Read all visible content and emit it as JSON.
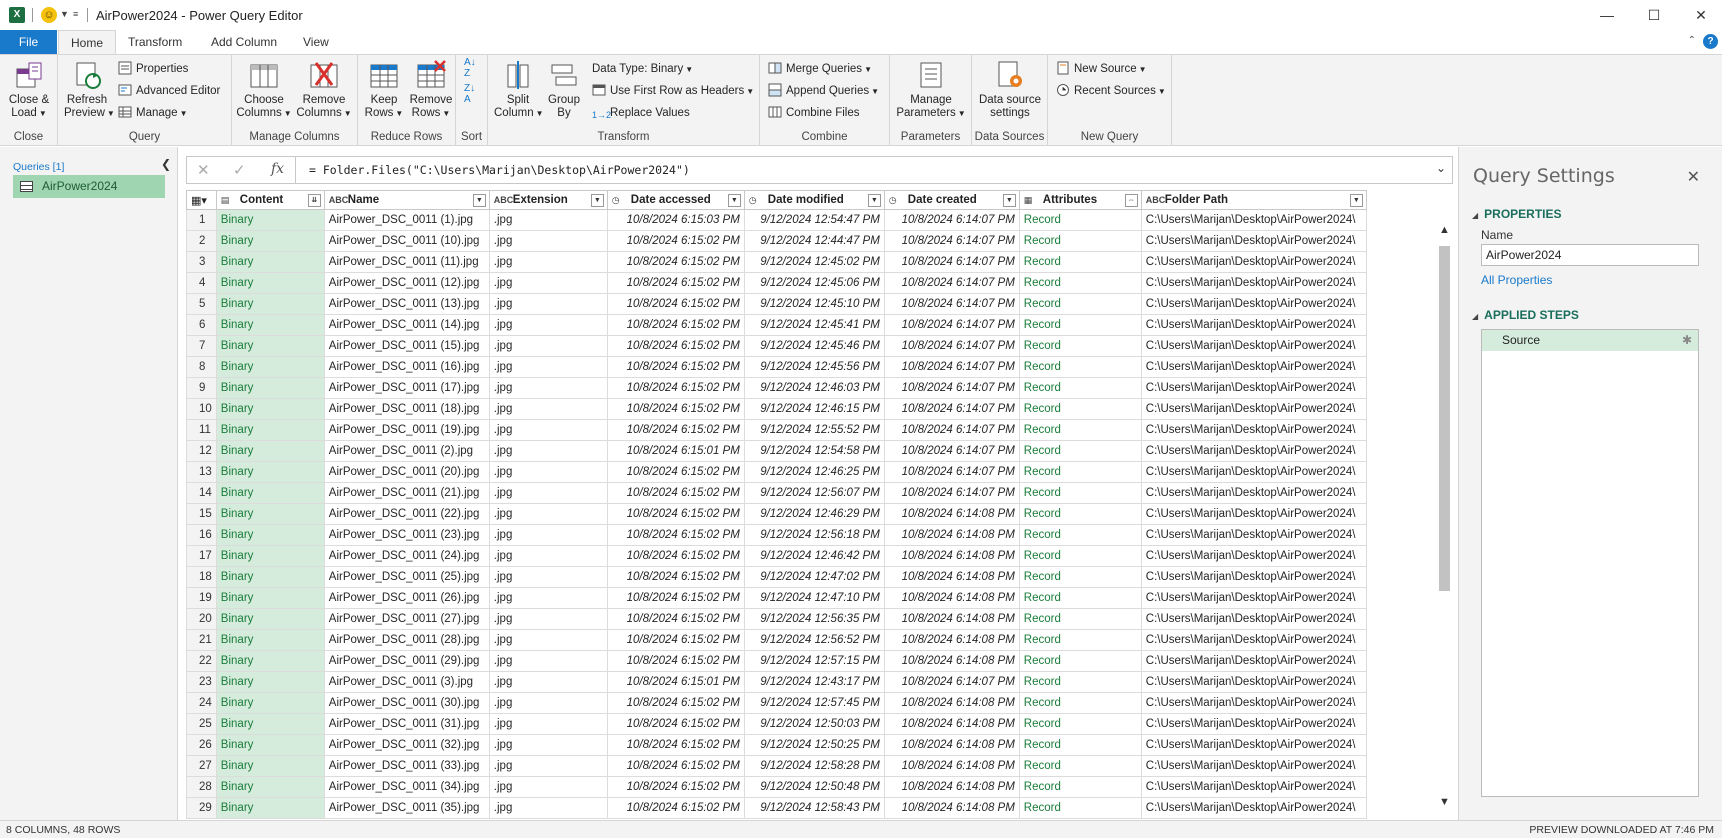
{
  "window": {
    "title": "AirPower2024 - Power Query Editor",
    "minimize": "—",
    "maximize": "☐",
    "close": "✕"
  },
  "tabs": [
    "File",
    "Home",
    "Transform",
    "Add Column",
    "View"
  ],
  "ribbon": {
    "close_group": {
      "label": "Close",
      "close_load": "Close &",
      "close_load2": "Load"
    },
    "query_group": {
      "label": "Query",
      "refresh": "Refresh",
      "refresh2": "Preview",
      "properties": "Properties",
      "advanced_editor": "Advanced Editor",
      "manage": "Manage"
    },
    "manage_columns_group": {
      "label": "Manage Columns",
      "choose": "Choose",
      "choose2": "Columns",
      "remove": "Remove",
      "remove2": "Columns"
    },
    "reduce_rows_group": {
      "label": "Reduce Rows",
      "keep": "Keep",
      "keep2": "Rows",
      "remove": "Remove",
      "remove2": "Rows"
    },
    "sort_group": {
      "label": "Sort"
    },
    "transform_group": {
      "label": "Transform",
      "split": "Split",
      "split2": "Column",
      "group": "Group",
      "group2": "By",
      "data_type": "Data Type: Binary",
      "first_row": "Use First Row as Headers",
      "replace": "Replace Values"
    },
    "combine_group": {
      "label": "Combine",
      "merge": "Merge Queries",
      "append": "Append Queries",
      "combine_files": "Combine Files"
    },
    "parameters_group": {
      "label": "Parameters",
      "manage": "Manage",
      "manage2": "Parameters"
    },
    "data_sources_group": {
      "label": "Data Sources",
      "settings": "Data source",
      "settings2": "settings"
    },
    "new_query_group": {
      "label": "New Query",
      "new_source": "New Source",
      "recent_sources": "Recent Sources"
    }
  },
  "queries": {
    "header": "Queries [1]",
    "items": [
      "AirPower2024"
    ]
  },
  "formula": "= Folder.Files(\"C:\\Users\\Marijan\\Desktop\\AirPower2024\")",
  "columns": [
    "Content",
    "Name",
    "Extension",
    "Date accessed",
    "Date modified",
    "Date created",
    "Attributes",
    "Folder Path"
  ],
  "column_type_icons": [
    "▤",
    "ABC",
    "ABC",
    "◷",
    "◷",
    "◷",
    "▦",
    "ABC"
  ],
  "rows": [
    [
      "1",
      "Binary",
      "AirPower_DSC_0011 (1).jpg",
      ".jpg",
      "10/8/2024 6:15:03 PM",
      "9/12/2024 12:54:47 PM",
      "10/8/2024 6:14:07 PM",
      "Record",
      "C:\\Users\\Marijan\\Desktop\\AirPower2024\\"
    ],
    [
      "2",
      "Binary",
      "AirPower_DSC_0011 (10).jpg",
      ".jpg",
      "10/8/2024 6:15:02 PM",
      "9/12/2024 12:44:47 PM",
      "10/8/2024 6:14:07 PM",
      "Record",
      "C:\\Users\\Marijan\\Desktop\\AirPower2024\\"
    ],
    [
      "3",
      "Binary",
      "AirPower_DSC_0011 (11).jpg",
      ".jpg",
      "10/8/2024 6:15:02 PM",
      "9/12/2024 12:45:02 PM",
      "10/8/2024 6:14:07 PM",
      "Record",
      "C:\\Users\\Marijan\\Desktop\\AirPower2024\\"
    ],
    [
      "4",
      "Binary",
      "AirPower_DSC_0011 (12).jpg",
      ".jpg",
      "10/8/2024 6:15:02 PM",
      "9/12/2024 12:45:06 PM",
      "10/8/2024 6:14:07 PM",
      "Record",
      "C:\\Users\\Marijan\\Desktop\\AirPower2024\\"
    ],
    [
      "5",
      "Binary",
      "AirPower_DSC_0011 (13).jpg",
      ".jpg",
      "10/8/2024 6:15:02 PM",
      "9/12/2024 12:45:10 PM",
      "10/8/2024 6:14:07 PM",
      "Record",
      "C:\\Users\\Marijan\\Desktop\\AirPower2024\\"
    ],
    [
      "6",
      "Binary",
      "AirPower_DSC_0011 (14).jpg",
      ".jpg",
      "10/8/2024 6:15:02 PM",
      "9/12/2024 12:45:41 PM",
      "10/8/2024 6:14:07 PM",
      "Record",
      "C:\\Users\\Marijan\\Desktop\\AirPower2024\\"
    ],
    [
      "7",
      "Binary",
      "AirPower_DSC_0011 (15).jpg",
      ".jpg",
      "10/8/2024 6:15:02 PM",
      "9/12/2024 12:45:46 PM",
      "10/8/2024 6:14:07 PM",
      "Record",
      "C:\\Users\\Marijan\\Desktop\\AirPower2024\\"
    ],
    [
      "8",
      "Binary",
      "AirPower_DSC_0011 (16).jpg",
      ".jpg",
      "10/8/2024 6:15:02 PM",
      "9/12/2024 12:45:56 PM",
      "10/8/2024 6:14:07 PM",
      "Record",
      "C:\\Users\\Marijan\\Desktop\\AirPower2024\\"
    ],
    [
      "9",
      "Binary",
      "AirPower_DSC_0011 (17).jpg",
      ".jpg",
      "10/8/2024 6:15:02 PM",
      "9/12/2024 12:46:03 PM",
      "10/8/2024 6:14:07 PM",
      "Record",
      "C:\\Users\\Marijan\\Desktop\\AirPower2024\\"
    ],
    [
      "10",
      "Binary",
      "AirPower_DSC_0011 (18).jpg",
      ".jpg",
      "10/8/2024 6:15:02 PM",
      "9/12/2024 12:46:15 PM",
      "10/8/2024 6:14:07 PM",
      "Record",
      "C:\\Users\\Marijan\\Desktop\\AirPower2024\\"
    ],
    [
      "11",
      "Binary",
      "AirPower_DSC_0011 (19).jpg",
      ".jpg",
      "10/8/2024 6:15:02 PM",
      "9/12/2024 12:55:52 PM",
      "10/8/2024 6:14:07 PM",
      "Record",
      "C:\\Users\\Marijan\\Desktop\\AirPower2024\\"
    ],
    [
      "12",
      "Binary",
      "AirPower_DSC_0011 (2).jpg",
      ".jpg",
      "10/8/2024 6:15:01 PM",
      "9/12/2024 12:54:58 PM",
      "10/8/2024 6:14:07 PM",
      "Record",
      "C:\\Users\\Marijan\\Desktop\\AirPower2024\\"
    ],
    [
      "13",
      "Binary",
      "AirPower_DSC_0011 (20).jpg",
      ".jpg",
      "10/8/2024 6:15:02 PM",
      "9/12/2024 12:46:25 PM",
      "10/8/2024 6:14:07 PM",
      "Record",
      "C:\\Users\\Marijan\\Desktop\\AirPower2024\\"
    ],
    [
      "14",
      "Binary",
      "AirPower_DSC_0011 (21).jpg",
      ".jpg",
      "10/8/2024 6:15:02 PM",
      "9/12/2024 12:56:07 PM",
      "10/8/2024 6:14:07 PM",
      "Record",
      "C:\\Users\\Marijan\\Desktop\\AirPower2024\\"
    ],
    [
      "15",
      "Binary",
      "AirPower_DSC_0011 (22).jpg",
      ".jpg",
      "10/8/2024 6:15:02 PM",
      "9/12/2024 12:46:29 PM",
      "10/8/2024 6:14:08 PM",
      "Record",
      "C:\\Users\\Marijan\\Desktop\\AirPower2024\\"
    ],
    [
      "16",
      "Binary",
      "AirPower_DSC_0011 (23).jpg",
      ".jpg",
      "10/8/2024 6:15:02 PM",
      "9/12/2024 12:56:18 PM",
      "10/8/2024 6:14:08 PM",
      "Record",
      "C:\\Users\\Marijan\\Desktop\\AirPower2024\\"
    ],
    [
      "17",
      "Binary",
      "AirPower_DSC_0011 (24).jpg",
      ".jpg",
      "10/8/2024 6:15:02 PM",
      "9/12/2024 12:46:42 PM",
      "10/8/2024 6:14:08 PM",
      "Record",
      "C:\\Users\\Marijan\\Desktop\\AirPower2024\\"
    ],
    [
      "18",
      "Binary",
      "AirPower_DSC_0011 (25).jpg",
      ".jpg",
      "10/8/2024 6:15:02 PM",
      "9/12/2024 12:47:02 PM",
      "10/8/2024 6:14:08 PM",
      "Record",
      "C:\\Users\\Marijan\\Desktop\\AirPower2024\\"
    ],
    [
      "19",
      "Binary",
      "AirPower_DSC_0011 (26).jpg",
      ".jpg",
      "10/8/2024 6:15:02 PM",
      "9/12/2024 12:47:10 PM",
      "10/8/2024 6:14:08 PM",
      "Record",
      "C:\\Users\\Marijan\\Desktop\\AirPower2024\\"
    ],
    [
      "20",
      "Binary",
      "AirPower_DSC_0011 (27).jpg",
      ".jpg",
      "10/8/2024 6:15:02 PM",
      "9/12/2024 12:56:35 PM",
      "10/8/2024 6:14:08 PM",
      "Record",
      "C:\\Users\\Marijan\\Desktop\\AirPower2024\\"
    ],
    [
      "21",
      "Binary",
      "AirPower_DSC_0011 (28).jpg",
      ".jpg",
      "10/8/2024 6:15:02 PM",
      "9/12/2024 12:56:52 PM",
      "10/8/2024 6:14:08 PM",
      "Record",
      "C:\\Users\\Marijan\\Desktop\\AirPower2024\\"
    ],
    [
      "22",
      "Binary",
      "AirPower_DSC_0011 (29).jpg",
      ".jpg",
      "10/8/2024 6:15:02 PM",
      "9/12/2024 12:57:15 PM",
      "10/8/2024 6:14:08 PM",
      "Record",
      "C:\\Users\\Marijan\\Desktop\\AirPower2024\\"
    ],
    [
      "23",
      "Binary",
      "AirPower_DSC_0011 (3).jpg",
      ".jpg",
      "10/8/2024 6:15:01 PM",
      "9/12/2024 12:43:17 PM",
      "10/8/2024 6:14:07 PM",
      "Record",
      "C:\\Users\\Marijan\\Desktop\\AirPower2024\\"
    ],
    [
      "24",
      "Binary",
      "AirPower_DSC_0011 (30).jpg",
      ".jpg",
      "10/8/2024 6:15:02 PM",
      "9/12/2024 12:57:45 PM",
      "10/8/2024 6:14:08 PM",
      "Record",
      "C:\\Users\\Marijan\\Desktop\\AirPower2024\\"
    ],
    [
      "25",
      "Binary",
      "AirPower_DSC_0011 (31).jpg",
      ".jpg",
      "10/8/2024 6:15:02 PM",
      "9/12/2024 12:50:03 PM",
      "10/8/2024 6:14:08 PM",
      "Record",
      "C:\\Users\\Marijan\\Desktop\\AirPower2024\\"
    ],
    [
      "26",
      "Binary",
      "AirPower_DSC_0011 (32).jpg",
      ".jpg",
      "10/8/2024 6:15:02 PM",
      "9/12/2024 12:50:25 PM",
      "10/8/2024 6:14:08 PM",
      "Record",
      "C:\\Users\\Marijan\\Desktop\\AirPower2024\\"
    ],
    [
      "27",
      "Binary",
      "AirPower_DSC_0011 (33).jpg",
      ".jpg",
      "10/8/2024 6:15:02 PM",
      "9/12/2024 12:58:28 PM",
      "10/8/2024 6:14:08 PM",
      "Record",
      "C:\\Users\\Marijan\\Desktop\\AirPower2024\\"
    ],
    [
      "28",
      "Binary",
      "AirPower_DSC_0011 (34).jpg",
      ".jpg",
      "10/8/2024 6:15:02 PM",
      "9/12/2024 12:50:48 PM",
      "10/8/2024 6:14:08 PM",
      "Record",
      "C:\\Users\\Marijan\\Desktop\\AirPower2024\\"
    ],
    [
      "29",
      "Binary",
      "AirPower_DSC_0011 (35).jpg",
      ".jpg",
      "10/8/2024 6:15:02 PM",
      "9/12/2024 12:58:43 PM",
      "10/8/2024 6:14:08 PM",
      "Record",
      "C:\\Users\\Marijan\\Desktop\\AirPower2024\\"
    ]
  ],
  "settings": {
    "title": "Query Settings",
    "properties_header": "PROPERTIES",
    "name_label": "Name",
    "name_value": "AirPower2024",
    "all_properties": "All Properties",
    "steps_header": "APPLIED STEPS",
    "steps": [
      "Source"
    ]
  },
  "status": {
    "left": "8 COLUMNS, 48 ROWS",
    "right": "PREVIEW DOWNLOADED AT 7:46 PM"
  },
  "colors": {
    "accent": "#1979ca",
    "binary_bg": "#d5ecdd",
    "record": "#1a7d3a",
    "query_selected": "#9fd5b0"
  }
}
